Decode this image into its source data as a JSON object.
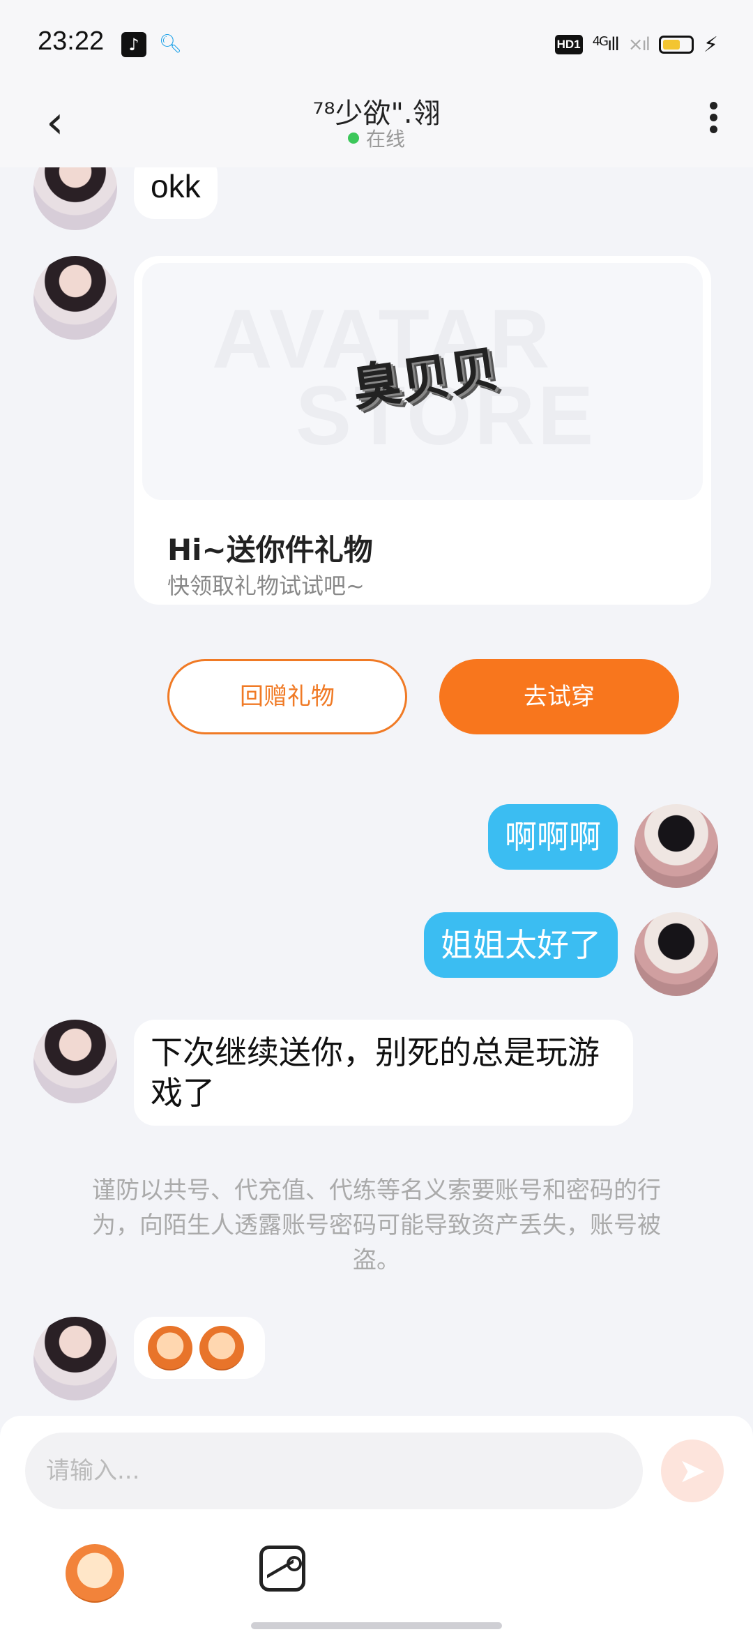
{
  "status_bar": {
    "time": "23:22",
    "tiktok_icon": "tiktok-icon",
    "search_icon": "search-icon",
    "hd": "HD1",
    "network": "4G",
    "signal": "ıll",
    "signal2": "×ıl",
    "charging": "⚡"
  },
  "header": {
    "title": "⁷⁸少欲\".翎",
    "status": "在线",
    "back_glyph": "‹"
  },
  "messages": [
    {
      "from": "other",
      "text": "okk"
    },
    {
      "from": "other",
      "type": "gift_card"
    },
    {
      "from": "me",
      "text": "啊啊啊"
    },
    {
      "from": "me",
      "text": "姐姐太好了"
    },
    {
      "from": "other",
      "text": "下次继续送你，别死的总是玩游戏了"
    }
  ],
  "gift_card": {
    "image_watermark_top": "AVATAR",
    "image_watermark_bottom": "STORE",
    "image_text": "臭贝贝",
    "title": "Hi~送你件礼物",
    "subtitle": "快领取礼物试试吧~",
    "return_gift_label": "回赠礼物",
    "try_on_label": "去试穿"
  },
  "system_notice": "谨防以共号、代充值、代练等名义索要账号和密码的行为，向陌生人透露账号密码可能导致资产丢失，账号被盗。",
  "input": {
    "placeholder": "请输入..."
  },
  "colors": {
    "accent_orange": "#f8761d",
    "my_bubble_blue": "#3bbdf2",
    "online_green": "#3cc75a"
  }
}
